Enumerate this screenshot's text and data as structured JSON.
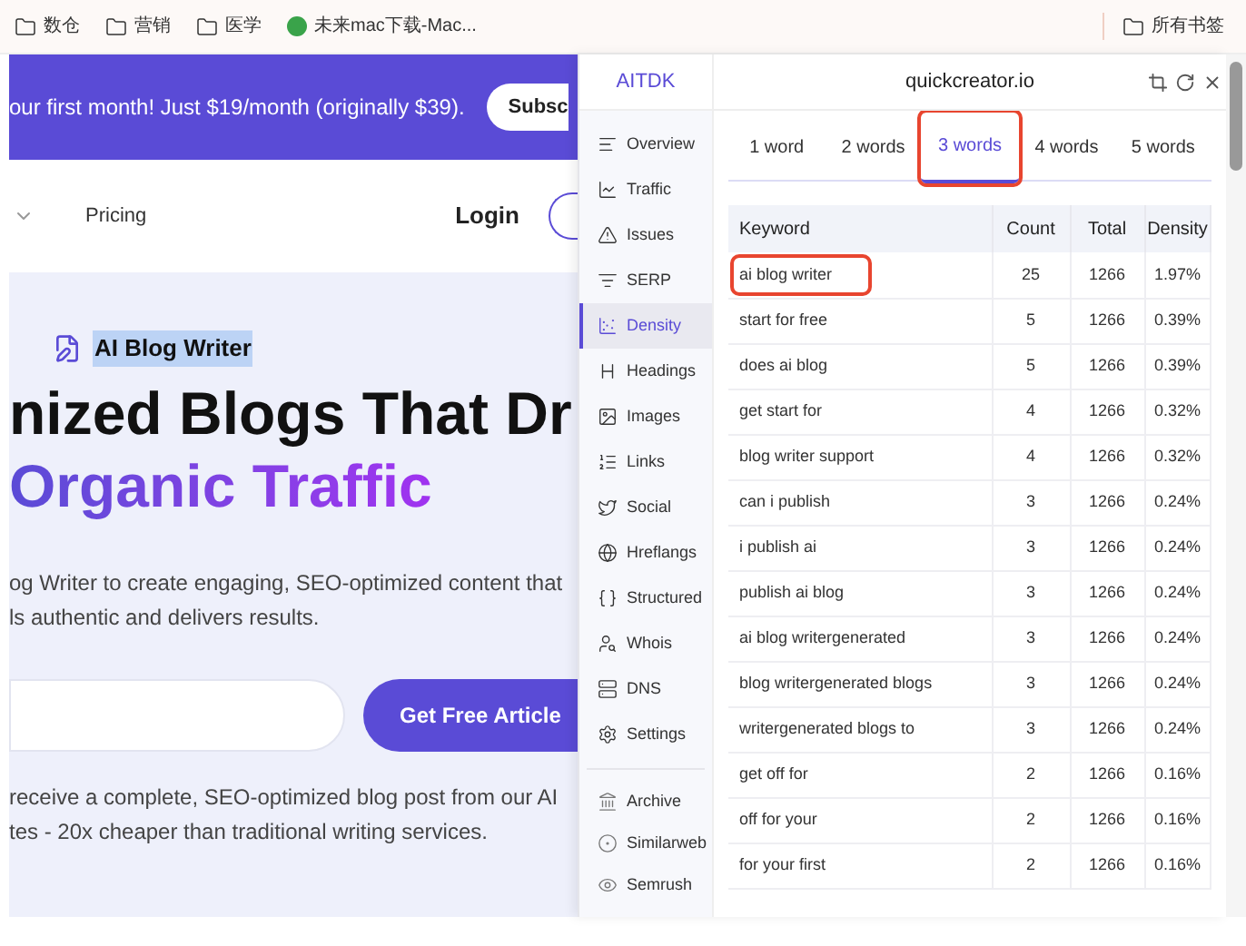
{
  "bookmarks": {
    "items": [
      {
        "label": "数仓",
        "kind": "folder"
      },
      {
        "label": "营销",
        "kind": "folder"
      },
      {
        "label": "医学",
        "kind": "folder"
      },
      {
        "label": "未来mac下载-Mac...",
        "kind": "site"
      }
    ],
    "all": "所有书签"
  },
  "page": {
    "banner": {
      "text": "our first month! Just $19/month (originally $39).",
      "button": "Subsc"
    },
    "nav": {
      "items": [
        "Pricing"
      ],
      "login": "Login"
    },
    "hero": {
      "badge": "AI Blog Writer",
      "title_1": "nized Blogs That Dr",
      "title_2": "Organic Traffic",
      "desc_1": "og Writer to create engaging, SEO-optimized content that",
      "desc_2": "ls authentic and delivers results.",
      "cta": "Get Free Article",
      "note_1": "receive a complete, SEO-optimized blog post from our AI",
      "note_2": "tes - 20x cheaper than traditional writing services."
    }
  },
  "extension": {
    "brand": "AITDK",
    "site": "quickcreator.io",
    "sidebar": {
      "items": [
        {
          "label": "Overview",
          "selected": false
        },
        {
          "label": "Traffic",
          "selected": false
        },
        {
          "label": "Issues",
          "selected": false
        },
        {
          "label": "SERP",
          "selected": false
        },
        {
          "label": "Density",
          "selected": true
        },
        {
          "label": "Headings",
          "selected": false
        },
        {
          "label": "Images",
          "selected": false
        },
        {
          "label": "Links",
          "selected": false
        },
        {
          "label": "Social",
          "selected": false
        },
        {
          "label": "Hreflangs",
          "selected": false
        },
        {
          "label": "Structured",
          "selected": false
        },
        {
          "label": "Whois",
          "selected": false
        },
        {
          "label": "DNS",
          "selected": false
        },
        {
          "label": "Settings",
          "selected": false
        }
      ],
      "tools": [
        "Archive",
        "Similarweb",
        "Semrush"
      ]
    },
    "tabs": [
      {
        "label": "1 word",
        "selected": false,
        "circled": false
      },
      {
        "label": "2 words",
        "selected": false,
        "circled": false
      },
      {
        "label": "3 words",
        "selected": true,
        "circled": true
      },
      {
        "label": "4 words",
        "selected": false,
        "circled": false
      },
      {
        "label": "5 words",
        "selected": false,
        "circled": false
      }
    ],
    "table": {
      "columns": [
        "Keyword",
        "Count",
        "Total",
        "Density"
      ],
      "rows": [
        {
          "cells": [
            "ai blog writer",
            "25",
            "1266",
            "1.97%"
          ],
          "circled": true
        },
        {
          "cells": [
            "start for free",
            "5",
            "1266",
            "0.39%"
          ],
          "circled": false
        },
        {
          "cells": [
            "does ai blog",
            "5",
            "1266",
            "0.39%"
          ],
          "circled": false
        },
        {
          "cells": [
            "get start for",
            "4",
            "1266",
            "0.32%"
          ],
          "circled": false
        },
        {
          "cells": [
            "blog writer support",
            "4",
            "1266",
            "0.32%"
          ],
          "circled": false
        },
        {
          "cells": [
            "can i publish",
            "3",
            "1266",
            "0.24%"
          ],
          "circled": false
        },
        {
          "cells": [
            "i publish ai",
            "3",
            "1266",
            "0.24%"
          ],
          "circled": false
        },
        {
          "cells": [
            "publish ai blog",
            "3",
            "1266",
            "0.24%"
          ],
          "circled": false
        },
        {
          "cells": [
            "ai blog writergenerated",
            "3",
            "1266",
            "0.24%"
          ],
          "circled": false
        },
        {
          "cells": [
            "blog writergenerated blogs",
            "3",
            "1266",
            "0.24%"
          ],
          "circled": false
        },
        {
          "cells": [
            "writergenerated blogs to",
            "3",
            "1266",
            "0.24%"
          ],
          "circled": false
        },
        {
          "cells": [
            "get off for",
            "2",
            "1266",
            "0.16%"
          ],
          "circled": false
        },
        {
          "cells": [
            "off for your",
            "2",
            "1266",
            "0.16%"
          ],
          "circled": false
        },
        {
          "cells": [
            "for your first",
            "2",
            "1266",
            "0.16%"
          ],
          "circled": false
        }
      ]
    }
  }
}
